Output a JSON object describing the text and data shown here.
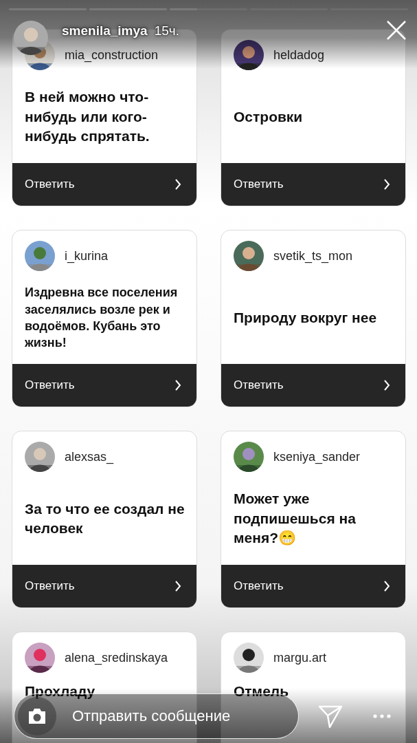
{
  "progress": [
    {
      "level": 1
    },
    {
      "level": 1
    },
    {
      "level": 0.35
    },
    {
      "level": 0
    },
    {
      "level": 0
    }
  ],
  "story": {
    "username": "smenila_imya",
    "time": "15ч."
  },
  "cards": [
    {
      "username": "mia_construction",
      "text": "В ней можно что-нибудь или кого-нибудь спрятать.",
      "reply": "Ответить"
    },
    {
      "username": "heldadog",
      "text": "Островки",
      "reply": "Ответить"
    },
    {
      "username": "i_kurina",
      "text": "Издревна все поселения заселялись возле рек и водоёмов. Кубань это жизнь!",
      "reply": "Ответить"
    },
    {
      "username": "svetik_ts_mon",
      "text": "Природу вокруг нее",
      "reply": "Ответить"
    },
    {
      "username": "alexsas_",
      "text": "За то что ее создал не человек",
      "reply": "Ответить"
    },
    {
      "username": "kseniya_sander",
      "text": "Может уже подпишешься на меня?😁",
      "reply": "Ответить"
    },
    {
      "username": "alena_sredinskaya",
      "text": "Прохладу"
    },
    {
      "username": "margu.art",
      "text": "Отмель"
    }
  ],
  "composer": {
    "placeholder": "Отправить сообщение"
  }
}
